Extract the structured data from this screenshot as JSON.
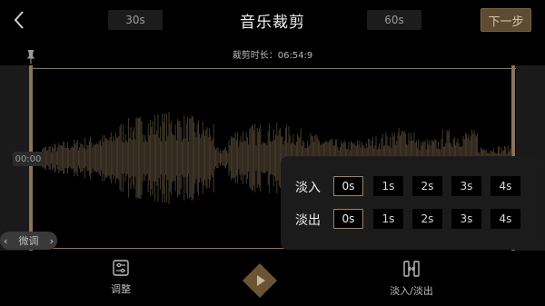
{
  "header": {
    "back_icon": "chevron-left-icon",
    "preset_left": "30s",
    "title": "音乐裁剪",
    "preset_right": "60s",
    "next_label": "下一步"
  },
  "trim": {
    "duration_text": "裁剪时长：06:54:9",
    "start_time": "00:00",
    "fine_tune_label": "微调"
  },
  "colors": {
    "accent": "#a38359",
    "waveform": "#4a3e2e",
    "next_button": "#5f4a32"
  },
  "bottom": {
    "adjust_label": "调整",
    "fade_label": "淡入/淡出"
  },
  "fade_panel": {
    "fade_in_label": "淡入",
    "fade_out_label": "淡出",
    "options": [
      "0s",
      "1s",
      "2s",
      "3s",
      "4s"
    ],
    "fade_in_selected": "0s",
    "fade_out_selected": "0s"
  }
}
